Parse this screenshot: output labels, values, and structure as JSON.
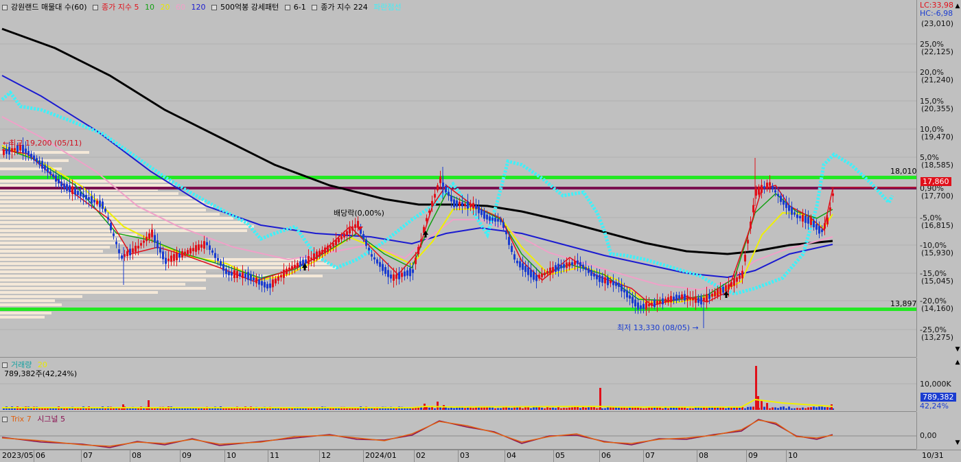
{
  "legend_main": {
    "stock": "강원랜드 매물대 수(60)",
    "ma_label": "종가 지수 5",
    "ma10": "10",
    "ma20": "20",
    "ma60": "60",
    "ma120": "120",
    "pattern": "500억봉 강세패턴",
    "pattern2": "6-1",
    "ma224": "종가 지수 224",
    "cloud": "파란점선"
  },
  "legend_volume": {
    "label": "거래량",
    "period": "20",
    "value": "789,382주(42,24%)"
  },
  "legend_trix": {
    "label": "Trix 7",
    "signal": "시그널 5"
  },
  "annotations": {
    "high": "최고 19,200 (05/11)",
    "low": "최저 13,330 (08/05)",
    "dividend": "배당락(0,00%)",
    "level_upper": "18,010",
    "level_lower": "13,897"
  },
  "right_axis": {
    "lc": "LC:33,98",
    "hc": "HC:-6,98",
    "top_price": "(23,010)",
    "current_price": "17,860",
    "ticks": [
      {
        "pct": "25,0%",
        "price": "(22,125)"
      },
      {
        "pct": "20,0%",
        "price": "(21,240)"
      },
      {
        "pct": "15,0%",
        "price": "(20,355)"
      },
      {
        "pct": "10,0%",
        "price": "(19,470)"
      },
      {
        "pct": "5,0%",
        "price": "(18,585)"
      },
      {
        "pct": "0,90%",
        "price": "(17,700)"
      },
      {
        "pct": "-5,0%",
        "price": "(16,815)"
      },
      {
        "pct": "-10,0%",
        "price": "(15,930)"
      },
      {
        "pct": "-15,0%",
        "price": "(15,045)"
      },
      {
        "pct": "-20,0%",
        "price": "(14,160)"
      },
      {
        "pct": "-25,0%",
        "price": "(13,275)"
      }
    ],
    "volume_tick": "10,000K",
    "volume_current": "789,382",
    "volume_pct": "42,24%",
    "trix_tick": "0,00"
  },
  "date_axis": [
    "2023/05",
    "06",
    "07",
    "08",
    "09",
    "10",
    "11",
    "12",
    "2024/01",
    "02",
    "03",
    "04",
    "05",
    "06",
    "07",
    "08",
    "09",
    "10",
    "10/31"
  ],
  "colors": {
    "background": "#c0c0c0",
    "ma5": "#e0101a",
    "ma10": "#12a012",
    "ma20": "#f0f000",
    "ma60": "#f0a0c8",
    "ma120": "#1a1ad0",
    "ma224": "#000000",
    "cloud": "#40f0f8",
    "support": "#22e822",
    "resistance": "#7a1050",
    "up_candle": "#e0101a",
    "down_candle": "#1a3cd0",
    "volume_profile": "#f4e8d8"
  }
}
